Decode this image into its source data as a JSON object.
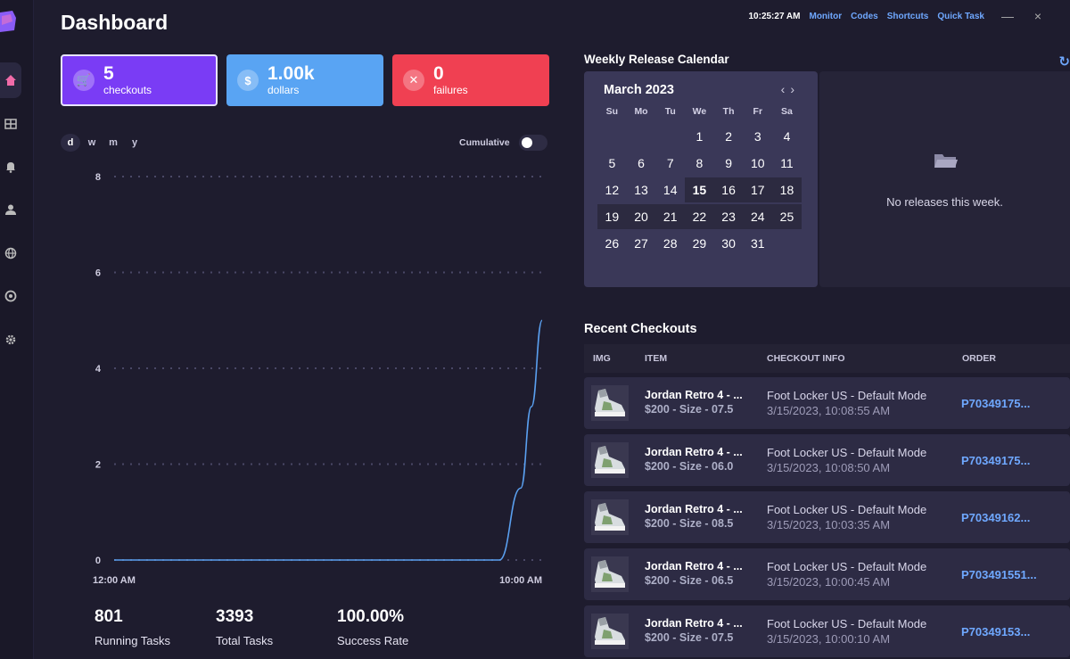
{
  "page": {
    "title": "Dashboard"
  },
  "topbar": {
    "time": "10:25:27 AM",
    "links": [
      "Monitor",
      "Codes",
      "Shortcuts",
      "Quick Task"
    ],
    "minimize": "—",
    "close": "×"
  },
  "sidebar": {
    "items": [
      {
        "icon": "home-icon",
        "active": true
      },
      {
        "icon": "grid-icon",
        "active": false
      },
      {
        "icon": "bell-icon",
        "active": false
      },
      {
        "icon": "user-icon",
        "active": false
      },
      {
        "icon": "globe-icon",
        "active": false
      },
      {
        "icon": "chrome-icon",
        "active": false
      },
      {
        "icon": "gear-icon",
        "active": false
      }
    ]
  },
  "stats": {
    "checkouts": {
      "value": "5",
      "label": "checkouts",
      "icon": "cart-icon",
      "icon_glyph": "🛒",
      "color": "#7a3cf5"
    },
    "dollars": {
      "value": "1.00k",
      "label": "dollars",
      "icon": "dollar-icon",
      "icon_glyph": "$",
      "color": "#59a4f3"
    },
    "failures": {
      "value": "0",
      "label": "failures",
      "icon": "x-icon",
      "icon_glyph": "✕",
      "color": "#f04052"
    }
  },
  "chart_controls": {
    "ranges": [
      "d",
      "w",
      "m",
      "y"
    ],
    "active_range": "d",
    "cumulative_label": "Cumulative",
    "cumulative_on": false
  },
  "chart_data": {
    "type": "line",
    "title": "",
    "xlabel": "",
    "ylabel": "",
    "x_tick_labels": [
      "12:00 AM",
      "10:00 AM"
    ],
    "x_range": [
      "12:00 AM",
      "10:00 AM"
    ],
    "y_ticks": [
      0,
      2,
      4,
      6,
      8
    ],
    "ylim": [
      0,
      8
    ],
    "grid": true,
    "series": [
      {
        "color": "#5aa0f0",
        "x": [
          "12:00 AM",
          "1:00 AM",
          "2:00 AM",
          "3:00 AM",
          "4:00 AM",
          "5:00 AM",
          "6:00 AM",
          "7:00 AM",
          "8:00 AM",
          "9:00 AM",
          "9:30 AM",
          "9:45 AM",
          "10:00 AM"
        ],
        "y": [
          0,
          0,
          0,
          0,
          0,
          0,
          0,
          0,
          0,
          0,
          1.5,
          3.2,
          5
        ]
      }
    ]
  },
  "bottom_stats": [
    {
      "value": "801",
      "label": "Running Tasks"
    },
    {
      "value": "3393",
      "label": "Total Tasks"
    },
    {
      "value": "100.00%",
      "label": "Success Rate"
    }
  ],
  "calendar": {
    "section_title": "Weekly Release Calendar",
    "month": "March 2023",
    "prev": "‹",
    "next": "›",
    "days_of_week": [
      "Su",
      "Mo",
      "Tu",
      "We",
      "Th",
      "Fr",
      "Sa"
    ],
    "weeks": [
      [
        "",
        "",
        "",
        "1",
        "2",
        "3",
        "4"
      ],
      [
        "5",
        "6",
        "7",
        "8",
        "9",
        "10",
        "11"
      ],
      [
        "12",
        "13",
        "14",
        "15",
        "16",
        "17",
        "18"
      ],
      [
        "19",
        "20",
        "21",
        "22",
        "23",
        "24",
        "25"
      ],
      [
        "26",
        "27",
        "28",
        "29",
        "30",
        "31",
        ""
      ]
    ],
    "today": "15",
    "dotted_days": [
      "4",
      "11"
    ],
    "highlighted_week": 2,
    "empty_message": "No releases this week.",
    "refresh_icon": "refresh-icon",
    "refresh_glyph": "↻"
  },
  "checkouts": {
    "section_title": "Recent Checkouts",
    "columns": [
      "IMG",
      "ITEM",
      "CHECKOUT INFO",
      "ORDER"
    ],
    "rows": [
      {
        "item": "Jordan Retro 4 - ...",
        "price_size": "$200 - Size - 07.5",
        "store": "Foot Locker US - Default Mode",
        "date": "3/15/2023, 10:08:55 AM",
        "order": "P70349175..."
      },
      {
        "item": "Jordan Retro 4 - ...",
        "price_size": "$200 - Size - 06.0",
        "store": "Foot Locker US - Default Mode",
        "date": "3/15/2023, 10:08:50 AM",
        "order": "P70349175..."
      },
      {
        "item": "Jordan Retro 4 - ...",
        "price_size": "$200 - Size - 08.5",
        "store": "Foot Locker US - Default Mode",
        "date": "3/15/2023, 10:03:35 AM",
        "order": "P70349162..."
      },
      {
        "item": "Jordan Retro 4 - ...",
        "price_size": "$200 - Size - 06.5",
        "store": "Foot Locker US - Default Mode",
        "date": "3/15/2023, 10:00:45 AM",
        "order": "P703491551..."
      },
      {
        "item": "Jordan Retro 4 - ...",
        "price_size": "$200 - Size - 07.5",
        "store": "Foot Locker US - Default Mode",
        "date": "3/15/2023, 10:00:10 AM",
        "order": "P70349153..."
      }
    ]
  }
}
